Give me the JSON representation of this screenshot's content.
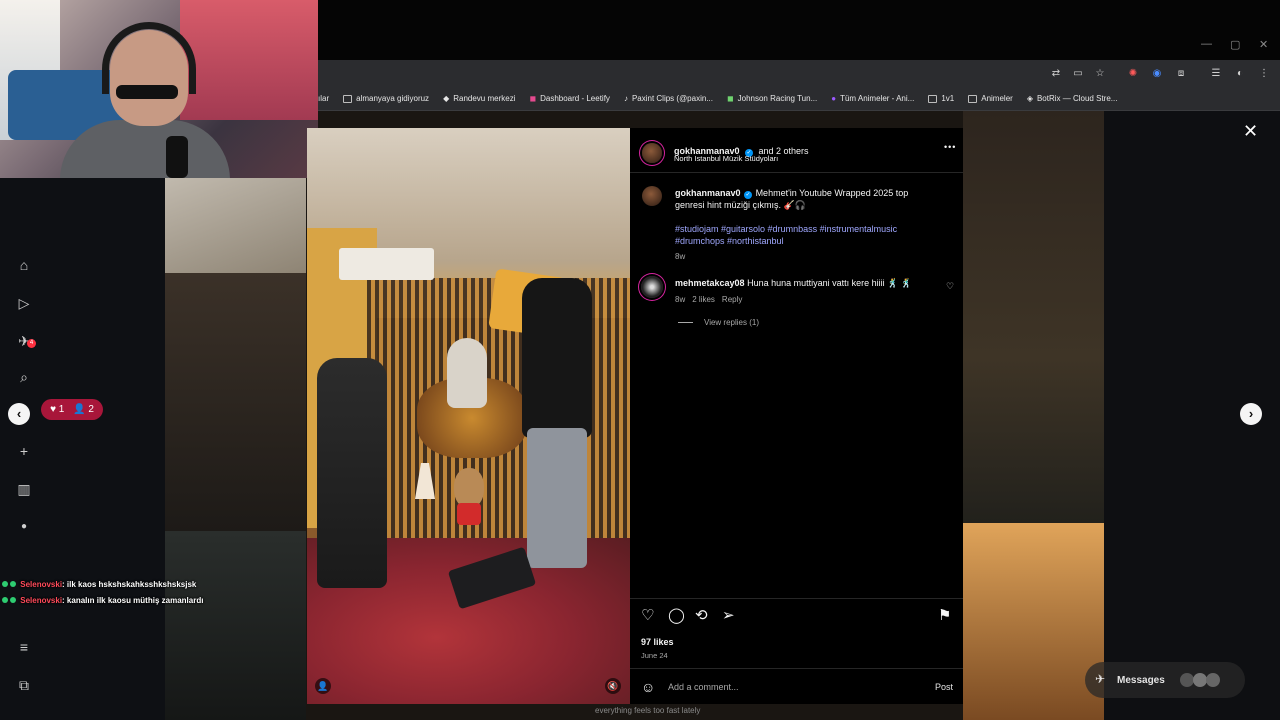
{
  "window": {
    "controls": [
      "—",
      "▢",
      "✕"
    ]
  },
  "bookmarks": [
    {
      "label": "ılar",
      "icon": "folder-icon"
    },
    {
      "label": "almanyaya gidiyoruz",
      "icon": "folder-icon"
    },
    {
      "label": "Randevu merkezi",
      "icon": "site-icon"
    },
    {
      "label": "Dashboard - Leetify",
      "icon": "site-icon"
    },
    {
      "label": "Paxint Clips (@paxin...",
      "icon": "tiktok-icon"
    },
    {
      "label": "Johnson Racing Tun...",
      "icon": "site-icon"
    },
    {
      "label": "Tüm Animeler - Ani...",
      "icon": "site-icon"
    },
    {
      "label": "1v1",
      "icon": "folder-icon"
    },
    {
      "label": "Animeler",
      "icon": "folder-icon"
    },
    {
      "label": "BotRix — Cloud Stre...",
      "icon": "site-icon"
    }
  ],
  "sidebar": {
    "notification_badge": "4",
    "pill_hearts": "1",
    "pill_users": "2"
  },
  "post": {
    "header_user": "gokhanmanav0",
    "header_and_others": "and 2 others",
    "location": "North Istanbul Müzik Stüdyoları",
    "more_label": "•••",
    "caption_user": "gokhanmanav0",
    "caption_text": "Mehmet'in Youtube Wrapped 2025 top genresi hint müziği çıkmış. 🎸🎧",
    "hashtags": "#studiojam #guitarsolo #drumnbass #instrumentalmusic #drumchops #northistanbul",
    "caption_age": "8w",
    "comment": {
      "user": "mehmetakcay08",
      "text": "Huna huna muttiyani vattı kere hiiii 🕺 🕺",
      "age": "8w",
      "likes": "2 likes",
      "reply_label": "Reply",
      "view_replies": "View replies (1)"
    },
    "likes": "97 likes",
    "date": "June 24",
    "comment_placeholder": "Add a comment...",
    "post_button": "Post"
  },
  "chat": [
    {
      "nick": "Selenovski",
      "message": ": ilk kaos hskshskahksshkshsksjsk"
    },
    {
      "nick": "Selenovski",
      "message": ": kanalın ilk kaosu müthiş zamanlardı"
    }
  ],
  "messages_label": "Messages",
  "subtitle": "everything feels too fast lately",
  "colors": {
    "link": "#a0a8ff",
    "verified": "#0095f6",
    "chat_nick": "#ff4a5a",
    "pill": "#a8163a"
  }
}
